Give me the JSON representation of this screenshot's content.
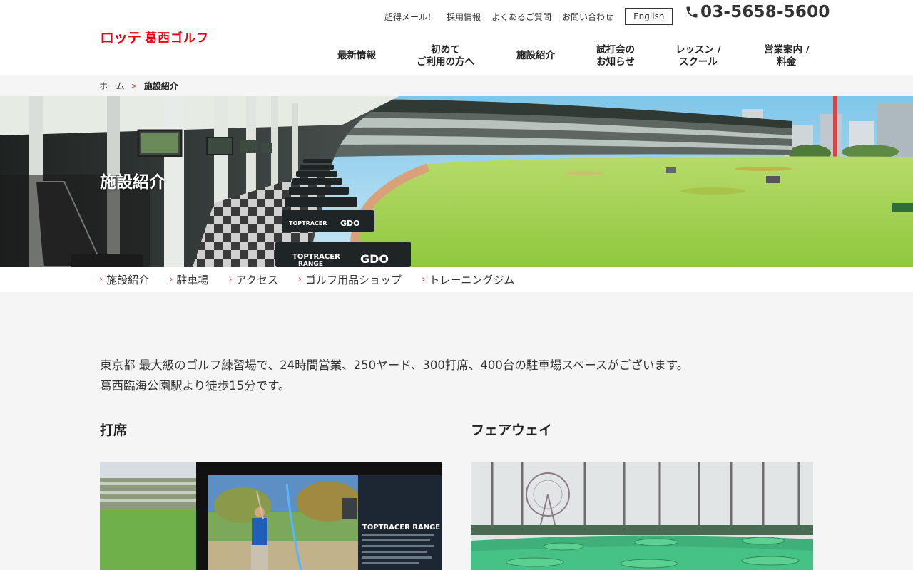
{
  "header": {
    "logo_mark": "ロッテ",
    "logo_text": "葛西ゴルフ",
    "util_links": [
      "超得メール！",
      "採用情報",
      "よくあるご質問",
      "お問い合わせ"
    ],
    "english_label": "English",
    "phone": "03-5658-5600",
    "nav": [
      {
        "line1": "最新情報",
        "line2": ""
      },
      {
        "line1": "初めて",
        "line2": "ご利用の方へ"
      },
      {
        "line1": "施設紹介",
        "line2": ""
      },
      {
        "line1": "試打会の",
        "line2": "お知らせ"
      },
      {
        "line1": "レッスン /",
        "line2": "スクール"
      },
      {
        "line1": "営業案内 /",
        "line2": "料金"
      }
    ]
  },
  "breadcrumb": {
    "home": "ホーム",
    "separator": ">",
    "current": "施設紹介"
  },
  "hero": {
    "title": "施設紹介",
    "range_sign_top": "TOPTRACER",
    "range_sign_bottom": "RANGE",
    "range_brand": "GDO"
  },
  "sub_nav": {
    "chevron": "›",
    "items": [
      "施設紹介",
      "駐車場",
      "アクセス",
      "ゴルフ用品ショップ",
      "トレーニングジム"
    ]
  },
  "intro": {
    "line1": "東京都 最大級のゴルフ練習場で、24時間営業、250ヤード、300打席、400台の駐車場スペースがございます。",
    "line2": "葛西臨海公園駅より徒歩15分です。"
  },
  "sections": [
    {
      "title": "打席",
      "screen_text": "TOPTRACER RANGE"
    },
    {
      "title": "フェアウェイ"
    }
  ],
  "colors": {
    "accent_red": "#e60012",
    "chevron_red": "#e0443a",
    "turf_green": "#9bd24b",
    "fairway_green": "#3fb07a"
  }
}
